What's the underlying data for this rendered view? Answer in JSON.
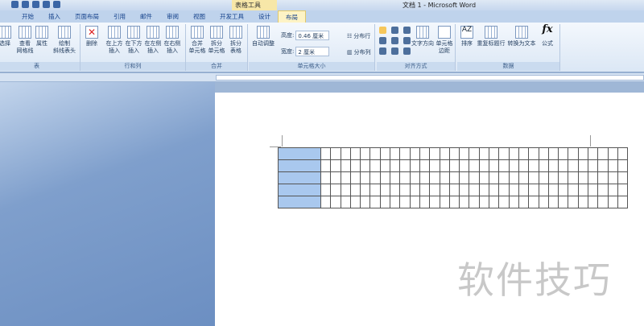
{
  "window": {
    "title": "文档 1 - Microsoft Word",
    "context_tab_group": "表格工具"
  },
  "tabs": [
    "开始",
    "插入",
    "页面布局",
    "引用",
    "邮件",
    "审阅",
    "视图",
    "开发工具",
    "设计",
    "布局"
  ],
  "active_tab": "布局",
  "groups": {
    "table": {
      "label": "表",
      "buttons": [
        "选择",
        "查看\n网格线",
        "属性",
        "绘制\n斜线表头"
      ]
    },
    "rows_cols": {
      "label": "行和列",
      "buttons": [
        "删除",
        "在上方\n插入",
        "在下方\n插入",
        "在左侧\n插入",
        "在右侧\n插入"
      ]
    },
    "merge": {
      "label": "合并",
      "buttons": [
        "合并\n单元格",
        "拆分\n单元格",
        "拆分\n表格"
      ]
    },
    "cell_size": {
      "label": "单元格大小",
      "autofit": "自动调整",
      "height_label": "高度:",
      "height_value": "0.46 厘米",
      "width_label": "宽度:",
      "width_value": "2 厘米",
      "dist_rows": "分布行",
      "dist_cols": "分布列"
    },
    "alignment": {
      "label": "对齐方式",
      "text_direction": "文字方向",
      "cell_margins": "单元格\n边距"
    },
    "data": {
      "label": "数据",
      "buttons": [
        "排序",
        "重复标题行",
        "转换为文本",
        "公式"
      ]
    }
  },
  "document": {
    "table_rows": 5,
    "table_cols": 32,
    "selected_column": 1
  },
  "watermark": "软件技巧"
}
